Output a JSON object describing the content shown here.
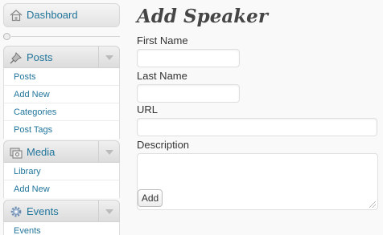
{
  "sidebar": {
    "dashboard_label": "Dashboard",
    "posts": {
      "label": "Posts",
      "items": [
        "Posts",
        "Add New",
        "Categories",
        "Post Tags"
      ]
    },
    "media": {
      "label": "Media",
      "items": [
        "Library",
        "Add New"
      ]
    },
    "events": {
      "label": "Events",
      "items": [
        "Events"
      ]
    }
  },
  "icons": {
    "dashboard": "house-icon",
    "posts": "pushpin-icon",
    "media": "media-icon",
    "events": "gear-icon",
    "collapse": "collapse-icon",
    "submenu_toggle": "chevron-down-icon"
  },
  "colors": {
    "link": "#21759b",
    "heading": "#464646",
    "background": "#f9f9f9"
  },
  "main": {
    "title": "Add Speaker",
    "first_name_label": "First Name",
    "first_name_value": "",
    "last_name_label": "Last Name",
    "last_name_value": "",
    "url_label": "URL",
    "url_value": "",
    "description_label": "Description",
    "description_value": "",
    "submit_label": "Add"
  }
}
